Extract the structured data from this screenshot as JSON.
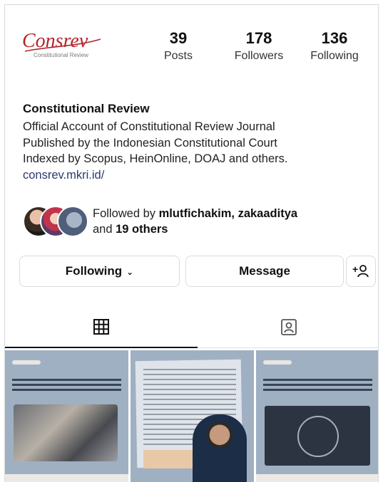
{
  "profile": {
    "logo_text": "Consrev",
    "logo_sub": "Constitutional Review",
    "stats": [
      {
        "key": "posts",
        "value": "39",
        "label": "Posts"
      },
      {
        "key": "followers",
        "value": "178",
        "label": "Followers"
      },
      {
        "key": "following",
        "value": "136",
        "label": "Following"
      }
    ],
    "name": "Constitutional Review",
    "bio": [
      "Official Account of Constitutional Review Journal",
      "Published by the Indonesian Constitutional Court",
      "Indexed by Scopus, HeinOnline, DOAJ and others."
    ],
    "link": "consrev.mkri.id/",
    "followed_prefix": "Followed by ",
    "followed_names": "mlutfichakim, zakaaditya",
    "followed_line2_prefix": "and ",
    "followed_others": "19 others"
  },
  "actions": {
    "following_label": "Following",
    "message_label": "Message"
  },
  "tabs": {
    "icons": [
      "grid-icon",
      "tagged-icon"
    ]
  },
  "colors": {
    "logo_red": "#b3262e",
    "tile_bg": "#9fb0c3",
    "link": "#2a3a6b"
  }
}
